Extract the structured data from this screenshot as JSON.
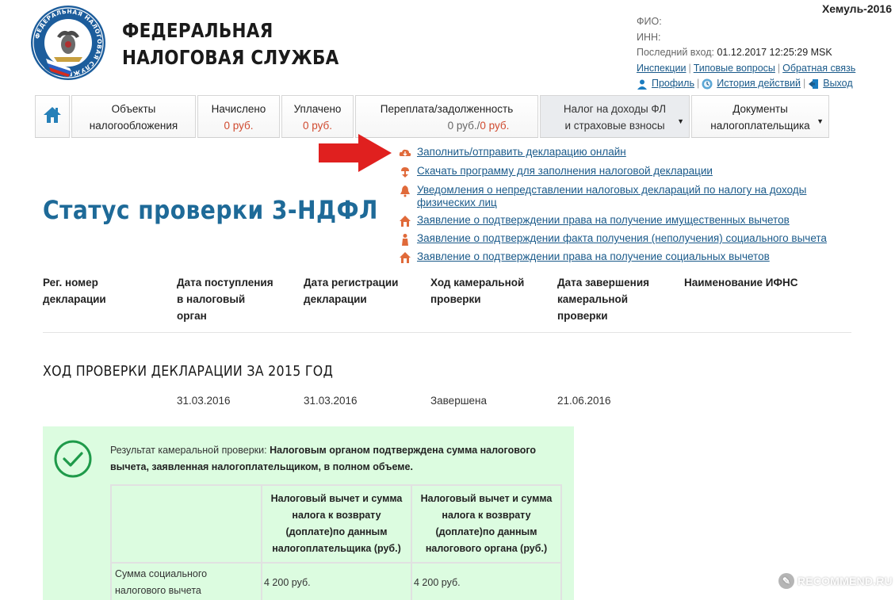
{
  "watermark_top": "Хемуль-2016",
  "brand": {
    "line1": "ФЕДЕРАЛЬНАЯ",
    "line2": "НАЛОГОВАЯ СЛУЖБА",
    "logo_ring_text": "ФЕДЕРАЛЬНАЯ НАЛОГОВАЯ СЛУЖБА"
  },
  "user": {
    "fio_label": "ФИО:",
    "inn_label": "ИНН:",
    "last_login_label": "Последний вход:",
    "last_login_value": "01.12.2017 12:25:29 MSK",
    "links_row1": [
      "Инспекции",
      "Типовые вопросы",
      "Обратная связь"
    ],
    "profile": "Профиль",
    "history": "История действий",
    "logout": "Выход"
  },
  "nav": {
    "home_icon": "home-icon",
    "tabs": [
      {
        "line1": "Объекты",
        "line2": "налогообложения"
      },
      {
        "line1": "Начислено",
        "line2": "0 руб."
      },
      {
        "line1": "Уплачено",
        "line2": "0 руб."
      },
      {
        "line1": "Переплата/задолженность",
        "amount1": "0 руб.",
        "slash": "/",
        "amount2": "0 руб."
      },
      {
        "line1": "Налог на доходы ФЛ",
        "line2": "и страховые взносы"
      },
      {
        "line1": "Документы",
        "line2": "налогоплательщика"
      }
    ]
  },
  "links": [
    {
      "text": "Заполнить/отправить декларацию онлайн",
      "icon": "cloud-icon"
    },
    {
      "text": "Скачать программу для заполнения налоговой декларации",
      "icon": "download-icon"
    },
    {
      "text": "Уведомления о непредставлении налоговых деклараций по налогу на доходы",
      "text2": "физических лиц",
      "icon": "bell-icon"
    },
    {
      "text": "Заявление о подтверждении права на получение имущественных вычетов",
      "icon": "house-icon"
    },
    {
      "text": "Заявление о подтверждении факта получения (неполучения) социального вычета",
      "icon": "person-icon"
    },
    {
      "text": "Заявление о подтверждении права на получение социальных вычетов",
      "icon": "house-icon"
    }
  ],
  "title": "Статус проверки 3-НДФЛ",
  "table": {
    "headers": [
      [
        "Рег. номер",
        "декларации"
      ],
      [
        "Дата поступления",
        "в налоговый",
        "орган"
      ],
      [
        "Дата регистрации",
        "декларации"
      ],
      [
        "Ход камеральной",
        "проверки"
      ],
      [
        "Дата завершения",
        "камеральной",
        "проверки"
      ],
      [
        "Наименование ИФНС"
      ]
    ],
    "section_title": "ХОД ПРОВЕРКИ ДЕКЛАРАЦИИ ЗА 2015 ГОД",
    "row": {
      "received": "31.03.2016",
      "registered": "31.03.2016",
      "status": "Завершена",
      "completed": "21.06.2016"
    }
  },
  "result": {
    "label": "Результат камеральной проверки:",
    "bold_line1": "Налоговым органом подтверждена сумма налогового",
    "bold_line2": "вычета, заявленная налогоплательщиком, в полном объеме.",
    "col1": [
      "Налоговый вычет и сумма",
      "налога к возврату",
      "(доплате)по данным",
      "налогоплательщика (руб.)"
    ],
    "col2": [
      "Налоговый вычет и сумма",
      "налога к возврату",
      "(доплате)по данным",
      "налогового органа (руб.)"
    ],
    "row_label": [
      "Сумма социального",
      "налогового вычета"
    ],
    "v1": "4 200 руб.",
    "v2": "4 200 руб."
  },
  "recommend_watermark": "RECOMMEND.RU",
  "colors": {
    "accent": "#1e6a98",
    "link": "#1a5a8a",
    "amount": "#d04a2f",
    "result_bg": "#dcfce0",
    "arrow": "#e0201f",
    "icon": "#e06a3a"
  }
}
